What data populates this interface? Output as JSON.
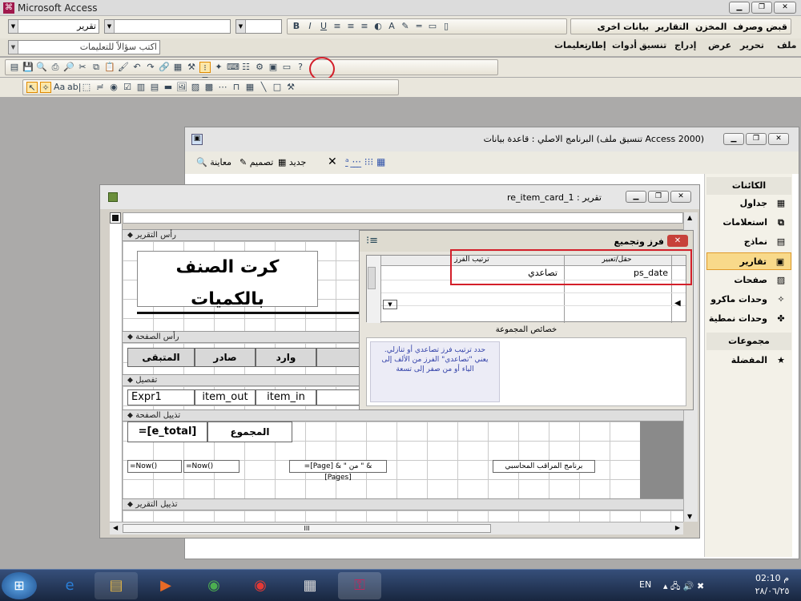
{
  "app": {
    "title": "Microsoft Access"
  },
  "menus": [
    "قبض وصرف",
    "المخزن",
    "التقارير",
    "بيانات اخرى"
  ],
  "menubar2": [
    "ملف",
    "تحرير",
    "عرض",
    "إدراج",
    "تنسيق",
    "أدوات",
    "إطار",
    "تعليمات"
  ],
  "toolbar": {
    "object_combo": "تقرير",
    "help_box": "اكتب سؤالاً للتعليمات"
  },
  "db_window": {
    "title": "البرنامج الاصلي : قاعدة بيانات (تنسيق ملف Access 2000)",
    "buttons": {
      "preview": "معاينة",
      "design": "تصميم",
      "new": "جديد"
    },
    "objects_header": "الكائنات",
    "objects": [
      "جداول",
      "استعلامات",
      "نماذج",
      "تقارير",
      "صفحات",
      "وحدات ماكرو",
      "وحدات نمطية"
    ],
    "groups_header": "مجموعات",
    "groups": [
      "المفضلة"
    ]
  },
  "report_window": {
    "title": "re_item_card_1 : تقرير",
    "sections": {
      "report_header": "رأس التقرير",
      "page_header": "رأس الصفحة",
      "detail": "تفصيل",
      "page_footer": "تذييل الصفحة",
      "report_footer": "تذييل التقرير"
    },
    "report_title": "كرت الصنف بالكميات",
    "page_header_labels": [
      "المتبقى",
      "صادر",
      "وارد"
    ],
    "detail_fields": [
      "Expr1",
      "item_out",
      "item_in"
    ],
    "footer_field": "=[e_total]",
    "footer_label": "المجموع",
    "page_footer_items": [
      "=Now()",
      "=Now()",
      "=[Page] & \" من \" & [Pages]",
      "برنامج المراقب المحاسبي"
    ],
    "scroll": "III"
  },
  "dialog": {
    "title": "فرز وتجميع",
    "col_field": "حقل/تعبير",
    "col_order": "ترتيب الفرز",
    "field_value": "ps_date",
    "order_value": "تصاعدي",
    "group_props": "خصائص المجموعة",
    "help_text": "حدد ترتيب فرز تصاعدي أو تنازلي. يعني \"تصاعدي\" الفرز من الألف إلى الياء أو من صفر إلى تسعة"
  },
  "taskbar": {
    "lang": "EN",
    "time": "02:10 م",
    "date": "٢٨/٠٦/٢٥"
  }
}
